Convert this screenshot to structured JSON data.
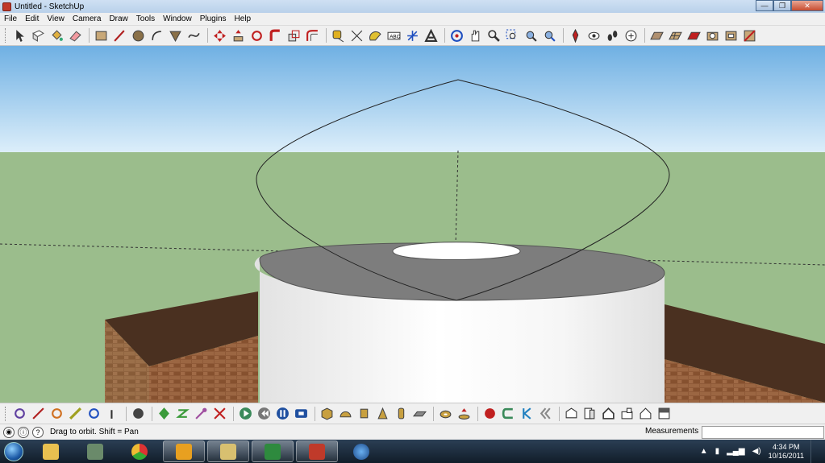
{
  "window": {
    "title": "Untitled - SketchUp"
  },
  "window_controls": {
    "minimize": "—",
    "maximize": "❐",
    "close": "✕"
  },
  "menu": [
    "File",
    "Edit",
    "View",
    "Camera",
    "Draw",
    "Tools",
    "Window",
    "Plugins",
    "Help"
  ],
  "statusbar": {
    "help_icon": "?",
    "hint": "Drag to orbit.  Shift = Pan",
    "measurements_label": "Measurements",
    "measurements_value": ""
  },
  "scene": {
    "sky_top": "#6fb0e3",
    "sky_bottom": "#dceefa",
    "ground": "#9bbd8c",
    "cylinder_top": "#7d7d7d",
    "cylinder_side": "#f2f2f2",
    "brick": "#8b5a3a",
    "brick_top": "#4a3020"
  },
  "taskbar": {
    "apps": [
      "folder-app",
      "computer-app",
      "chrome-app",
      "outlook-app",
      "explorer-app",
      "excel-app",
      "sketchup-app",
      "google-earth-app"
    ],
    "time": "4:34 PM",
    "date": "10/16/2011"
  },
  "accent": "#3a6fb0"
}
